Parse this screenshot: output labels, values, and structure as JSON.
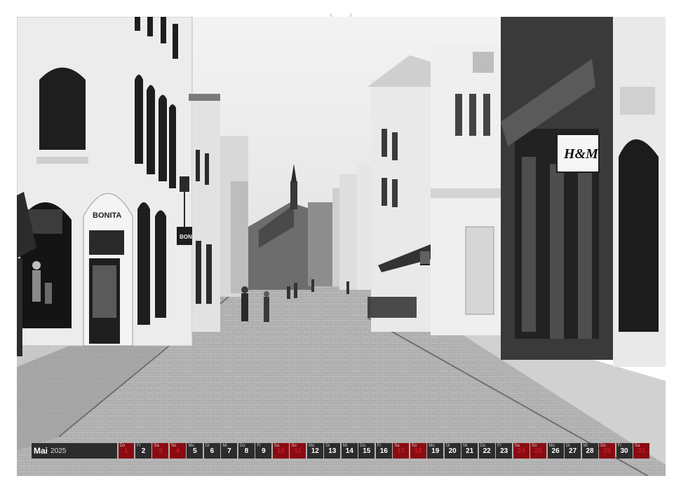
{
  "photo": {
    "description_hidden": "",
    "signs": {
      "bonita_wall": "BONITA",
      "bonita_hanging": "BONITA",
      "hm": "H&M"
    }
  },
  "calendar": {
    "month": "Mai",
    "year": "2025",
    "days": [
      {
        "d": "1",
        "w": "Do",
        "hol": true
      },
      {
        "d": "2",
        "w": "Fr",
        "hol": false
      },
      {
        "d": "3",
        "w": "Sa",
        "hol": true
      },
      {
        "d": "4",
        "w": "So",
        "hol": true
      },
      {
        "d": "5",
        "w": "Mo",
        "hol": false
      },
      {
        "d": "6",
        "w": "Di",
        "hol": false
      },
      {
        "d": "7",
        "w": "Mi",
        "hol": false
      },
      {
        "d": "8",
        "w": "Do",
        "hol": false
      },
      {
        "d": "9",
        "w": "Fr",
        "hol": false
      },
      {
        "d": "10",
        "w": "Sa",
        "hol": true
      },
      {
        "d": "11",
        "w": "So",
        "hol": true
      },
      {
        "d": "12",
        "w": "Mo",
        "hol": false
      },
      {
        "d": "13",
        "w": "Di",
        "hol": false
      },
      {
        "d": "14",
        "w": "Mi",
        "hol": false
      },
      {
        "d": "15",
        "w": "Do",
        "hol": false
      },
      {
        "d": "16",
        "w": "Fr",
        "hol": false
      },
      {
        "d": "17",
        "w": "Sa",
        "hol": true
      },
      {
        "d": "18",
        "w": "So",
        "hol": true
      },
      {
        "d": "19",
        "w": "Mo",
        "hol": false
      },
      {
        "d": "20",
        "w": "Di",
        "hol": false
      },
      {
        "d": "21",
        "w": "Mi",
        "hol": false
      },
      {
        "d": "22",
        "w": "Do",
        "hol": false
      },
      {
        "d": "23",
        "w": "Fr",
        "hol": false
      },
      {
        "d": "24",
        "w": "Sa",
        "hol": true
      },
      {
        "d": "25",
        "w": "So",
        "hol": true
      },
      {
        "d": "26",
        "w": "Mo",
        "hol": false
      },
      {
        "d": "27",
        "w": "Di",
        "hol": false
      },
      {
        "d": "28",
        "w": "Mi",
        "hol": false
      },
      {
        "d": "29",
        "w": "Do",
        "hol": true
      },
      {
        "d": "30",
        "w": "Fr",
        "hol": false
      },
      {
        "d": "31",
        "w": "Sa",
        "hol": true
      }
    ]
  }
}
